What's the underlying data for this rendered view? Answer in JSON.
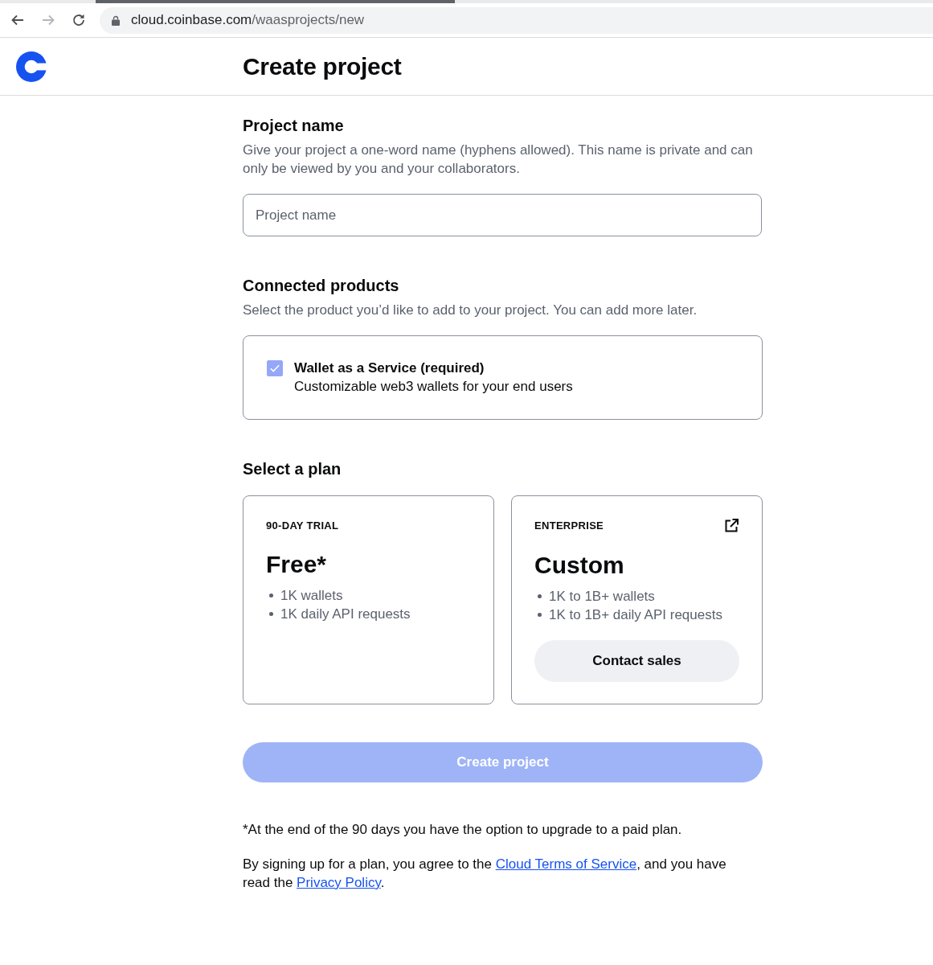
{
  "browser": {
    "nav_buttons": [
      {
        "kind": "back",
        "disabled": false
      },
      {
        "kind": "forward",
        "disabled": true
      },
      {
        "kind": "reload",
        "disabled": false
      }
    ],
    "url_host": "cloud.coinbase.com",
    "url_path": "/waasprojects/new"
  },
  "header": {
    "title": "Create project"
  },
  "project_name": {
    "heading": "Project name",
    "description": "Give your project a one-word name (hyphens allowed). This name is private and can only be viewed by you and your collaborators.",
    "field": {
      "placeholder": "Project name"
    }
  },
  "connected_products": {
    "heading": "Connected products",
    "description": "Select the product you’d like to add to your project. You can add more later.",
    "products": [
      {
        "title": "Wallet as a Service (required)",
        "subtitle": "Customizable web3 wallets for your end users",
        "checked": true,
        "disabled": true
      }
    ]
  },
  "plans": {
    "heading": "Select a plan",
    "items": [
      {
        "label": "90-DAY TRIAL",
        "name": "Free*",
        "features": [
          "1K wallets",
          "1K daily API requests"
        ],
        "external_link": false
      },
      {
        "label": "ENTERPRISE",
        "name": "Custom",
        "features": [
          "1K to 1B+ wallets",
          "1K to 1B+ daily API requests"
        ],
        "external_link": true,
        "action": "Contact sales"
      }
    ]
  },
  "submit": {
    "label": "Create project",
    "disabled": true
  },
  "footnote": "*At the end of the 90 days you have the option to upgrade to a paid plan.",
  "terms": [
    {
      "kind": "text",
      "text": "By signing up for a plan, you agree to the "
    },
    {
      "kind": "link",
      "text": "Cloud Terms of Service"
    },
    {
      "kind": "text",
      "text": ", and you have read the "
    },
    {
      "kind": "link",
      "text": "Privacy Policy"
    },
    {
      "kind": "text",
      "text": "."
    }
  ]
}
